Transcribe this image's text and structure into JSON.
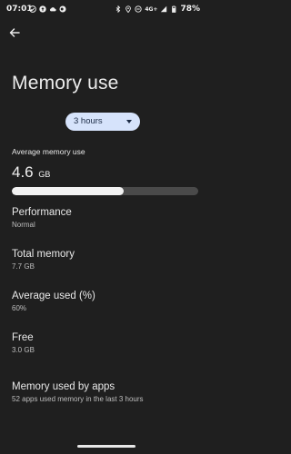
{
  "status_bar": {
    "time": "07:01",
    "network": "4G+",
    "battery": "78%",
    "left_icons": [
      "check-circle-icon",
      "cloud-upload-icon",
      "cloud-icon",
      "circle-dot-icon"
    ],
    "right_icons": [
      "bluetooth-icon",
      "location-icon",
      "do-not-disturb-icon",
      "signal-icon",
      "battery-icon"
    ]
  },
  "header": {
    "back_icon": "back-arrow-icon"
  },
  "page_title": "Memory use",
  "period_select": {
    "selected": "3 hours"
  },
  "average": {
    "label": "Average memory use",
    "value": "4.6",
    "unit": "GB",
    "fill_fraction": 0.6
  },
  "stats": [
    {
      "title": "Performance",
      "value": "Normal"
    },
    {
      "title": "Total memory",
      "value": "7.7 GB"
    },
    {
      "title": "Average used (%)",
      "value": "60%"
    },
    {
      "title": "Free",
      "value": "3.0 GB"
    },
    {
      "title": "Memory used by apps",
      "value": "52 apps used memory in the last 3 hours"
    }
  ],
  "colors": {
    "background": "#1f1f1f",
    "chip": "#d6e3fb",
    "bar_track": "#4a4a4a",
    "bar_fill": "#f2f2f2"
  }
}
